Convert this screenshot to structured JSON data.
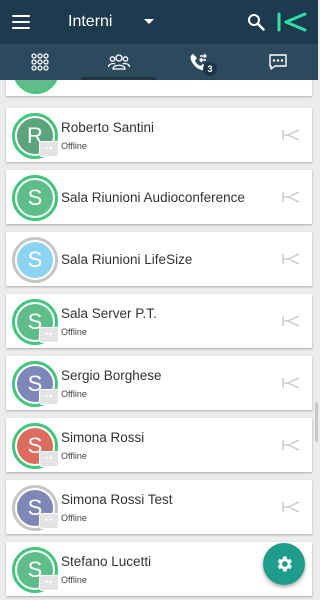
{
  "header": {
    "title": "Interni"
  },
  "tabs": [
    {
      "icon": "dialpad-icon"
    },
    {
      "icon": "contacts-icon",
      "active": true
    },
    {
      "icon": "call-transfer-icon",
      "badge": "3"
    },
    {
      "icon": "chat-icon"
    }
  ],
  "contacts": [
    {
      "initial": "R",
      "name": "Roberto Santini",
      "status": "Offline",
      "avatar_color": "#5aa57c",
      "ring_color": "#3fc87a",
      "has_status_chip": true
    },
    {
      "initial": "S",
      "name": "Sala Riunioni Audioconference",
      "status": "",
      "avatar_color": "#5fbd89",
      "ring_color": "#3fc87a",
      "has_status_chip": false
    },
    {
      "initial": "S",
      "name": "Sala Riunioni LifeSize",
      "status": "",
      "avatar_color": "#8dd3f2",
      "ring_color": "#c6c6c6",
      "has_status_chip": false
    },
    {
      "initial": "S",
      "name": "Sala Server P.T.",
      "status": "Offline",
      "avatar_color": "#5fbd89",
      "ring_color": "#3fc87a",
      "has_status_chip": true
    },
    {
      "initial": "S",
      "name": "Sergio Borghese",
      "status": "Offline",
      "avatar_color": "#7f87b8",
      "ring_color": "#3fc87a",
      "has_status_chip": true
    },
    {
      "initial": "S",
      "name": "Simona Rossi",
      "status": "Offline",
      "avatar_color": "#dd6b5e",
      "ring_color": "#3fc87a",
      "has_status_chip": true
    },
    {
      "initial": "S",
      "name": "Simona Rossi Test",
      "status": "Offline",
      "avatar_color": "#7f87b8",
      "ring_color": "#c6c6c6",
      "has_status_chip": true
    },
    {
      "initial": "S",
      "name": "Stefano Lucetti",
      "status": "Offline",
      "avatar_color": "#5fbd89",
      "ring_color": "#3fc87a",
      "has_status_chip": true
    }
  ],
  "colors": {
    "header_bg": "#1d3a4e",
    "tabbar_bg": "#2c495d",
    "accent_green": "#3fc87a",
    "fab_bg": "#1f9d8c"
  }
}
